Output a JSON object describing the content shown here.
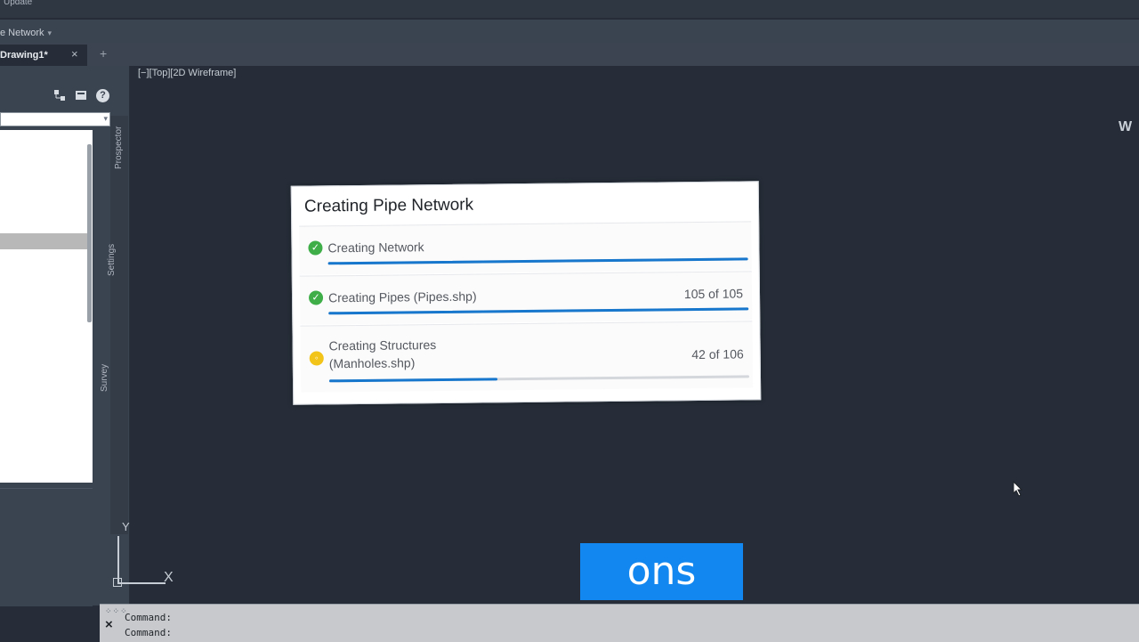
{
  "titlebar": {
    "update_label": "Update"
  },
  "ribbon": {
    "network_tab": "e Network",
    "network_tab_close": "▾"
  },
  "doc_tabs": [
    {
      "label": "Drawing1*",
      "close": "×"
    }
  ],
  "doc_add": "+",
  "palette": {
    "help_icon": "?",
    "vertical_tabs": [
      "Prospector",
      "Settings",
      "Survey"
    ]
  },
  "viewport": {
    "label": "[−][Top][2D Wireframe]",
    "viewcube_letter": "W"
  },
  "ucs": {
    "y": "Y",
    "x": "X"
  },
  "dialog": {
    "title": "Creating Pipe Network",
    "tasks": [
      {
        "label": "Creating Network",
        "count": "",
        "status": "done",
        "progress": 1.0
      },
      {
        "label": "Creating Pipes (Pipes.shp)",
        "count": "105 of 105",
        "status": "done",
        "progress": 1.0
      },
      {
        "label_line1": "Creating Structures",
        "label_line2": "(Manholes.shp)",
        "count": "42 of 106",
        "status": "in-progress",
        "progress": 0.4
      }
    ]
  },
  "caption": {
    "text": "ons"
  },
  "command": {
    "lines": [
      "Command:",
      "Command:"
    ],
    "close": "×",
    "grip": "⁘⁘⁘"
  },
  "colors": {
    "accent": "#1777cc",
    "done": "#3fae49",
    "pending": "#f2c318",
    "caption_bg": "#1187ef"
  }
}
